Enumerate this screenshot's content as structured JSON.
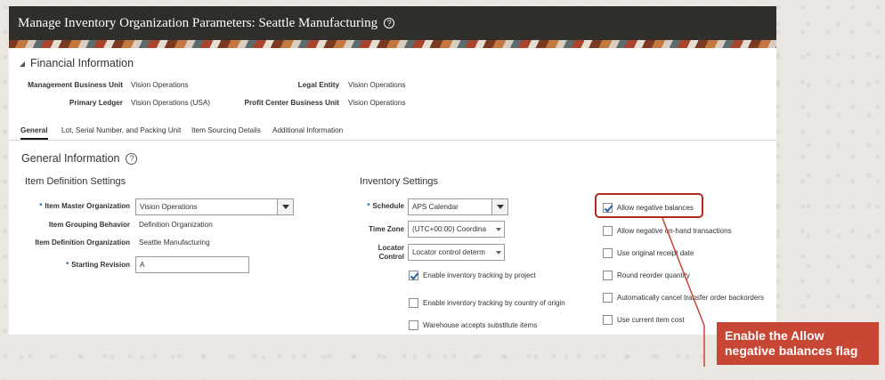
{
  "page": {
    "title": "Manage Inventory Organization Parameters: Seattle Manufacturing"
  },
  "financial": {
    "heading": "Financial Information",
    "management_bu_label": "Management Business Unit",
    "management_bu_value": "Vision Operations",
    "legal_entity_label": "Legal Entity",
    "legal_entity_value": "Vision Operations",
    "primary_ledger_label": "Primary Ledger",
    "primary_ledger_value": "Vision Operations (USA)",
    "profit_center_label": "Profit Center Business Unit",
    "profit_center_value": "Vision Operations"
  },
  "tabs": [
    {
      "label": "General",
      "active": true
    },
    {
      "label": "Lot, Serial Number, and Packing Unit",
      "active": false
    },
    {
      "label": "Item Sourcing Details",
      "active": false
    },
    {
      "label": "Additional Information",
      "active": false
    }
  ],
  "general": {
    "heading": "General Information",
    "item_def": {
      "heading": "Item Definition Settings",
      "master_org_label": "Item Master Organization",
      "master_org_value": "Vision Operations",
      "grouping_label": "Item Grouping Behavior",
      "grouping_value": "Definition Organization",
      "def_org_label": "Item Definition Organization",
      "def_org_value": "Seattle Manufacturing",
      "starting_rev_label": "Starting Revision",
      "starting_rev_value": "A"
    },
    "inventory": {
      "heading": "Inventory Settings",
      "schedule_label": "Schedule",
      "schedule_value": "APS Calendar",
      "timezone_label": "Time Zone",
      "timezone_value": "(UTC+00:00) Coordina",
      "locator_label_1": "Locator",
      "locator_label_2": "Control",
      "locator_value": "Locator control determ",
      "checkboxes": [
        {
          "label": "Enable inventory tracking by project",
          "checked": true
        },
        {
          "label": "Enable inventory tracking by country of origin",
          "checked": false
        },
        {
          "label": "Warehouse accepts substitute items",
          "checked": false
        }
      ]
    },
    "right_checkboxes": [
      {
        "label": "Allow negative balances",
        "checked": true
      },
      {
        "label": "Allow negative on-hand transactions",
        "checked": false
      },
      {
        "label": "Use original receipt date",
        "checked": false
      },
      {
        "label": "Round reorder quantity",
        "checked": false
      },
      {
        "label": "Automatically cancel transfer order backorders",
        "checked": false
      },
      {
        "label": "Use current item cost",
        "checked": false
      }
    ]
  },
  "callout": {
    "line1": "Enable the Allow",
    "line2": "negative balances flag"
  },
  "colors": {
    "titlebar": "#302e2b",
    "accent_blue": "#1e5fa8",
    "callout_red": "#c74634",
    "highlight_red": "#b2281c"
  }
}
